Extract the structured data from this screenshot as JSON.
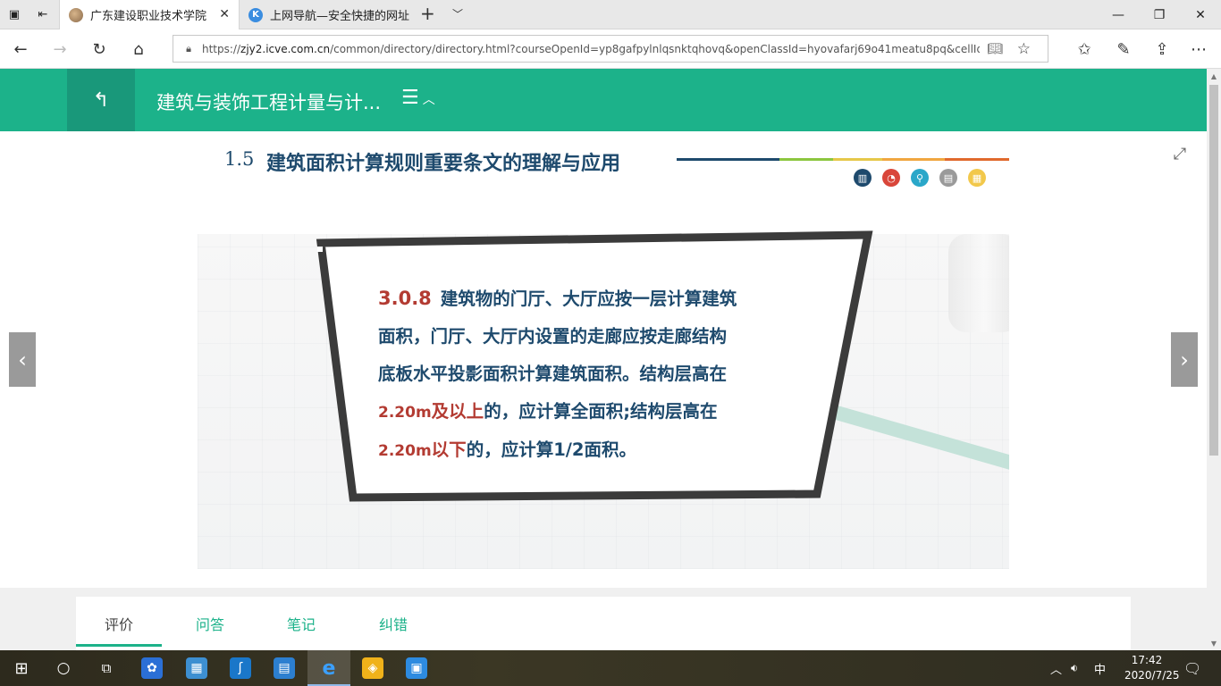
{
  "browser": {
    "tabs": [
      {
        "label": "广东建设职业技术学院",
        "active": true
      },
      {
        "label": "上网导航—安全快捷的网址",
        "active": false
      }
    ],
    "new_tab": "+",
    "url_prefix": "https://",
    "url_host": "zjy2.icve.com.cn",
    "url_path": "/common/directory/directory.html?courseOpenId=yp8gafpylnlqsnktqhovq&openClassId=hyovafarj69o41meatu8pq&cellId=pjttawir"
  },
  "course": {
    "title": "建筑与装饰工程计量与计...",
    "accent": "#1cb28a"
  },
  "slide": {
    "section_number": "1.5",
    "section_title": "建筑面积计算规则重要条文的理解与应用",
    "clause_number": "3.0.8",
    "clause": {
      "line1": "建筑物的门厅、大厅应按一层计算建筑",
      "line2": "面积，门厅、大厅内设置的走廊应按走廊结构",
      "line3": "底板水平投影面积计算建筑面积。结构层高在",
      "line4_num": "2.20m",
      "line4_red": "及以上",
      "line4_rest": "的，应计算全面积;结构层高在",
      "line5_num": "2.20m",
      "line5_red": "以下",
      "line5_rest": "的，应计算",
      "line5_frac": "1/2",
      "line5_end": "面积。"
    },
    "title_color": "#1e4a6d",
    "highlight_color": "#b33b32"
  },
  "bottom_tabs": [
    "评价",
    "问答",
    "笔记",
    "纠错"
  ],
  "taskbar": {
    "ime": "中",
    "time": "17:42",
    "date": "2020/7/25"
  }
}
